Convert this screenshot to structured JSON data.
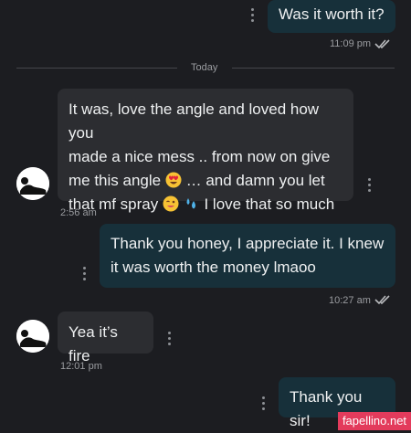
{
  "messages": [
    {
      "id": "m1",
      "direction": "out",
      "text": "Was it worth it?",
      "time": "11:09 pm"
    },
    {
      "id": "m2",
      "direction": "in",
      "text_lines": [
        "It was, love the angle and loved how you",
        "made a nice mess .. from now on give",
        "me this angle",
        "… and damn you let",
        "that mf spray",
        "I love that so much"
      ],
      "time": "2:56 am"
    },
    {
      "id": "m3",
      "direction": "out",
      "text_lines": [
        "Thank you honey, I appreciate it. I knew",
        "it was worth the money lmaoo"
      ],
      "time": "10:27 am"
    },
    {
      "id": "m4",
      "direction": "in",
      "text": "Yea it’s fire",
      "time": "12:01 pm"
    },
    {
      "id": "m5",
      "direction": "out",
      "text": "Thank you sir!"
    }
  ],
  "divider": {
    "label": "Today"
  },
  "watermark": {
    "text": "fapellino.net"
  },
  "colors": {
    "background": "#1c1d21",
    "outgoing_bubble": "#17303a",
    "incoming_bubble": "#2c2d31",
    "watermark": "#e33b5c"
  },
  "icons": [
    "kebab-menu-icon",
    "double-check-icon",
    "heart-eyes-emoji",
    "drooling-face-emoji",
    "sweat-droplets-emoji",
    "avatar-silhouette"
  ]
}
